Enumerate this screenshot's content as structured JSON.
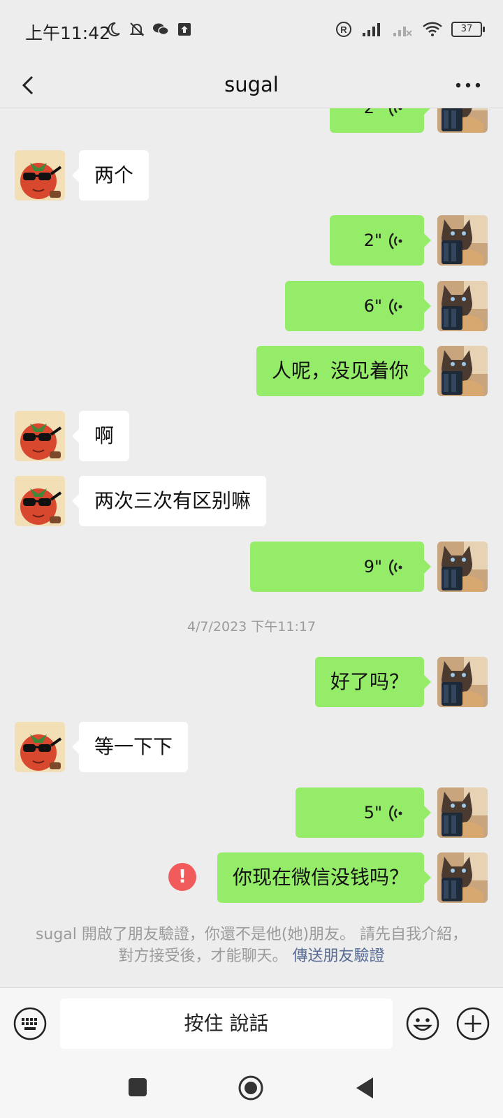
{
  "status_bar": {
    "time": "上午11:42",
    "battery": "37",
    "icons": [
      "moon-icon",
      "mute-icon",
      "wechat-icon",
      "upload-icon",
      "registered-icon",
      "signal-icon",
      "signal-icon",
      "wifi-icon",
      "battery-icon"
    ]
  },
  "header": {
    "title": "sugal",
    "back_icon": "chevron-left-icon",
    "more_icon": "more-icon"
  },
  "messages": [
    {
      "side": "out",
      "type": "voice",
      "duration": "2\"",
      "partial": true
    },
    {
      "side": "in",
      "type": "text",
      "text": "两个"
    },
    {
      "side": "out",
      "type": "voice",
      "duration": "2\""
    },
    {
      "side": "out",
      "type": "voice",
      "duration": "6\""
    },
    {
      "side": "out",
      "type": "text",
      "text": "人呢，没见着你"
    },
    {
      "side": "in",
      "type": "text",
      "text": "啊"
    },
    {
      "side": "in",
      "type": "text",
      "text": "两次三次有区别嘛"
    },
    {
      "side": "out",
      "type": "voice",
      "duration": "9\""
    },
    {
      "type": "timestamp",
      "text": "4/7/2023 下午11:17"
    },
    {
      "side": "out",
      "type": "text",
      "text": "好了吗？"
    },
    {
      "side": "in",
      "type": "text",
      "text": "等一下下"
    },
    {
      "side": "out",
      "type": "voice",
      "duration": "5\""
    },
    {
      "side": "out",
      "type": "text",
      "text": "你现在微信没钱吗？",
      "failed": true
    }
  ],
  "error_mark": "!",
  "system_note": {
    "text": "sugal 開啟了朋友驗證，你還不是他(她)朋友。 請先自我介紹，對方接受後，才能聊天。",
    "link": "傳送朋友驗證"
  },
  "input_bar": {
    "hold_to_talk": "按住 說話"
  },
  "colors": {
    "background": "#ededed",
    "outgoing_bubble": "#95ec69",
    "incoming_bubble": "#ffffff",
    "link": "#576b95",
    "error": "#f15b5b"
  }
}
